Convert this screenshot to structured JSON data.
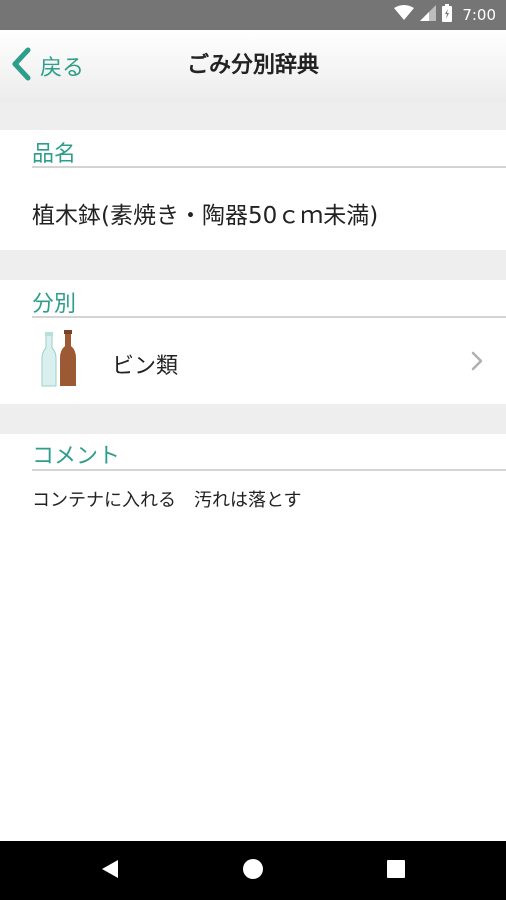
{
  "status_bar": {
    "time": "7:00",
    "icons": [
      "wifi-icon",
      "signal-icon",
      "battery-icon"
    ]
  },
  "header": {
    "back_label": "戻る",
    "title": "ごみ分別辞典"
  },
  "item": {
    "heading": "品名",
    "name": "植木鉢(素焼き・陶器50ｃｍ未満)"
  },
  "category": {
    "heading": "分別",
    "label": "ビン類",
    "icon": "bottles-icon"
  },
  "comment": {
    "heading": "コメント",
    "text": "コンテナに入れる　汚れは落とす"
  },
  "colors": {
    "accent": "#2e9e8a",
    "status_bar": "#757575",
    "section_gap": "#eeeeee",
    "nav_bar": "#000000"
  },
  "nav_bar": {
    "buttons": [
      "back-icon",
      "home-icon",
      "recents-icon"
    ]
  }
}
